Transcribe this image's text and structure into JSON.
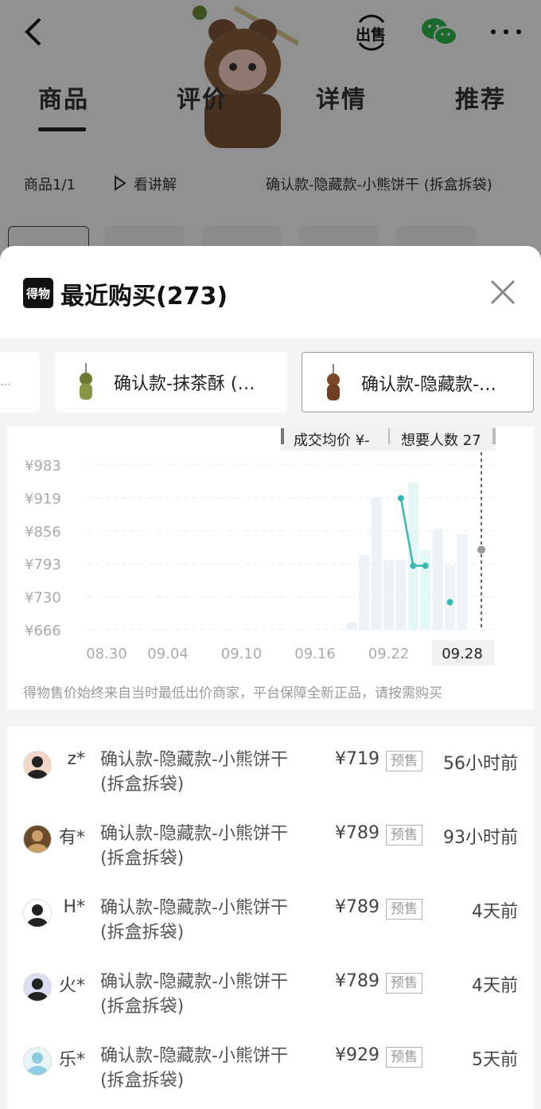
{
  "nav": {
    "sell_label": "出售",
    "tabs": [
      "商品",
      "评价",
      "详情",
      "推荐"
    ],
    "subbar": {
      "count": "商品1/1",
      "explain": "看讲解",
      "product_name": "确认款-隐藏款-小熊饼干 (拆盒拆袋)"
    }
  },
  "sheet": {
    "brand_text": "得物",
    "title": "最近购买(273)",
    "variants": [
      {
        "label": "确认款-抹茶酥 (…",
        "selected": false
      },
      {
        "label": "确认款-隐藏款-…",
        "selected": true
      }
    ],
    "partial_variant_text": "..."
  },
  "chart_data": {
    "type": "bar",
    "legend": {
      "avg_price": "成交均价 ¥-",
      "want_count": "想要人数 27"
    },
    "y_ticks": [
      "¥983",
      "¥919",
      "¥856",
      "¥793",
      "¥730",
      "¥666"
    ],
    "ylim": [
      666,
      983
    ],
    "x_ticks": [
      "08.30",
      "09.04",
      "09.10",
      "09.16",
      "09.22",
      "09.28"
    ],
    "selected_x": "09.28",
    "bars": {
      "dates": [
        "09.19",
        "09.20",
        "09.21",
        "09.22",
        "09.23",
        "09.24",
        "09.25",
        "09.26",
        "09.27",
        "09.28"
      ],
      "values": [
        680,
        810,
        920,
        800,
        800,
        950,
        820,
        860,
        790,
        850
      ]
    },
    "price_line": {
      "points": [
        {
          "x": "09.23",
          "y": 919
        },
        {
          "x": "09.24",
          "y": 789
        },
        {
          "x": "09.25",
          "y": 789
        }
      ],
      "isolated": [
        {
          "x": "09.27",
          "y": 719
        }
      ]
    },
    "marker_point": {
      "x": "09.28",
      "y": 820
    },
    "colors": {
      "line": "#3fb7b0",
      "bar": "#eef1f6",
      "bar_highlight": "#e4f6f6"
    }
  },
  "disclaimer": "得物售价始终来自当时最低出价商家，平台保障全新正品，请按需购买",
  "records": [
    {
      "buyer": "z*",
      "product": "确认款-隐藏款-小熊饼干 (拆盒拆袋)",
      "price": "¥719",
      "badge": "预售",
      "time": "56小时前"
    },
    {
      "buyer": "有*",
      "product": "确认款-隐藏款-小熊饼干 (拆盒拆袋)",
      "price": "¥789",
      "badge": "预售",
      "time": "93小时前"
    },
    {
      "buyer": "H*",
      "product": "确认款-隐藏款-小熊饼干 (拆盒拆袋)",
      "price": "¥789",
      "badge": "预售",
      "time": "4天前"
    },
    {
      "buyer": "火*",
      "product": "确认款-隐藏款-小熊饼干 (拆盒拆袋)",
      "price": "¥789",
      "badge": "预售",
      "time": "4天前"
    },
    {
      "buyer": "乐*",
      "product": "确认款-隐藏款-小熊饼干 (拆盒拆袋)",
      "price": "¥929",
      "badge": "预售",
      "time": "5天前"
    }
  ]
}
